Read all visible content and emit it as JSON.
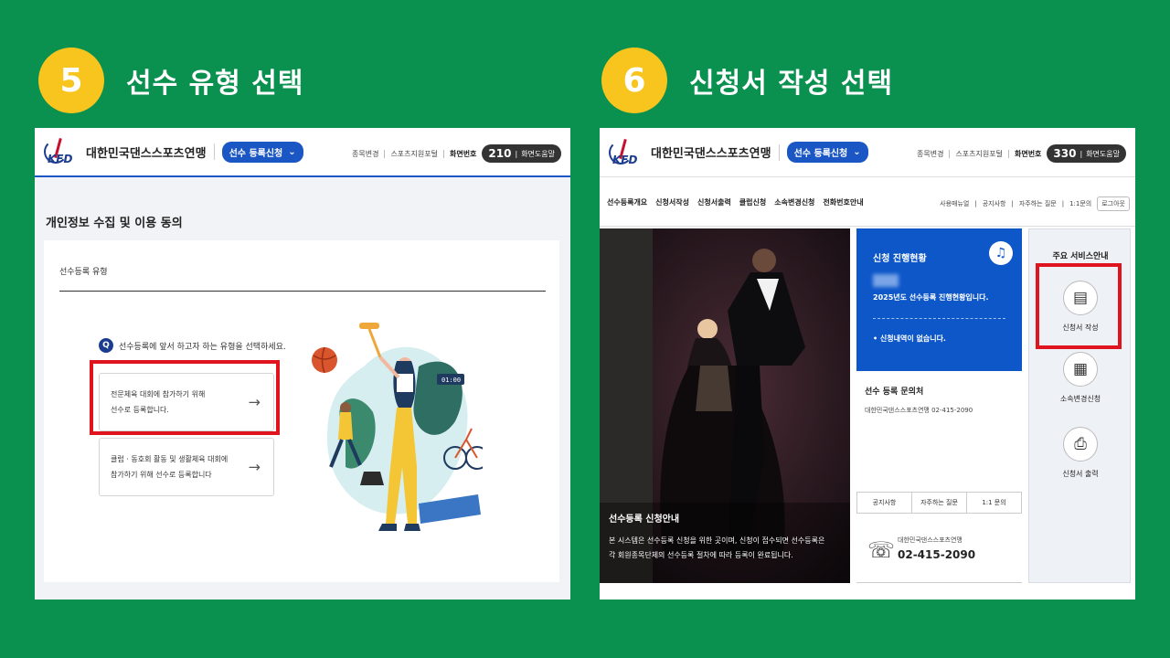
{
  "steps": [
    {
      "number": "5",
      "title": "선수 유형 선택"
    },
    {
      "number": "6",
      "title": "신청서 작성 선택"
    }
  ],
  "header": {
    "logo_text": "KFD",
    "org_name": "대한민국댄스스포츠연맹",
    "register_label": "선수 등록신청",
    "util_links": [
      "종목변경",
      "스포츠지원포털"
    ],
    "screen_label": "화면번호",
    "screen_help": "화면도움말"
  },
  "left": {
    "screen_number": "210",
    "page_title": "개인정보 수집 및 이용 동의",
    "section_label": "선수등록 유형",
    "question_badge": "Q",
    "question": "선수등록에 앞서 하고자 하는 유형을 선택하세요.",
    "options": [
      {
        "line1": "전문체육 대회에 참가하기 위해",
        "line2": "선수로 등록합니다."
      },
      {
        "line1": "클럽 · 동호회 활동 및 생활체육 대회에",
        "line2": "참가하기 위해 선수로 등록합니다"
      }
    ],
    "arrow": "→"
  },
  "right": {
    "screen_number": "330",
    "nav": [
      "선수등록개요",
      "신청서작성",
      "신청서출력",
      "클럽신청",
      "소속변경신청",
      "전화번호안내"
    ],
    "nav_right": [
      "사용매뉴얼",
      "공지사항",
      "자주하는 질문",
      "1:1문의"
    ],
    "logout": "로그아웃",
    "photo_title": "선수등록 신청안내",
    "photo_desc_1": "본 시스템은 선수등록 신청을 위한 곳이며, 신청이 접수되면 선수등록은",
    "photo_desc_2": "각 회원종목단체의 선수등록 절차에 따라 등록이 완료됩니다.",
    "status_title": "신청 진행현황",
    "status_year": "2025년도 선수등록 진행현황입니다.",
    "status_none": "• 신청내역이 없습니다.",
    "inquiry_title": "선수 등록 문의처",
    "inquiry_detail": "대한민국댄스스포츠연맹  02-415-2090",
    "tabs": [
      "공지사항",
      "자주하는 질문",
      "1:1 문의"
    ],
    "phone_org": "대한민국댄스스포츠연맹",
    "phone_number": "02-415-2090",
    "service_title": "주요 서비스안내",
    "services": [
      {
        "label": "신청서 작성",
        "icon": "document-icon"
      },
      {
        "label": "소속변경신청",
        "icon": "transfer-icon"
      },
      {
        "label": "신청서 출력",
        "icon": "printer-icon"
      }
    ]
  },
  "colors": {
    "background": "#0a9150",
    "step_circle": "#f7c51e",
    "highlight": "#e0141e",
    "primary": "#1a56c4"
  }
}
